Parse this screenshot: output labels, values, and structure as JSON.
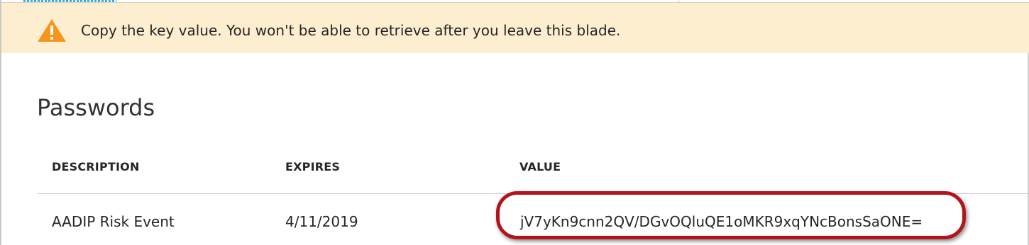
{
  "banner": {
    "icon": "warning-icon",
    "icon_color": "#f7941d",
    "message": "Copy the key value. You won't be able to retrieve after you leave this blade.",
    "background_color": "#fdeed0"
  },
  "section": {
    "title": "Passwords"
  },
  "table": {
    "headers": {
      "description": "DESCRIPTION",
      "expires": "EXPIRES",
      "value": "VALUE"
    },
    "rows": [
      {
        "description": "AADIP Risk Event",
        "expires": "4/11/2019",
        "value": "jV7yKn9cnn2QV/DGvOQluQE1oMKR9xqYNcBonsSaONE="
      }
    ]
  },
  "annotation": {
    "highlight_color": "#b3141c",
    "shape": "oval"
  }
}
